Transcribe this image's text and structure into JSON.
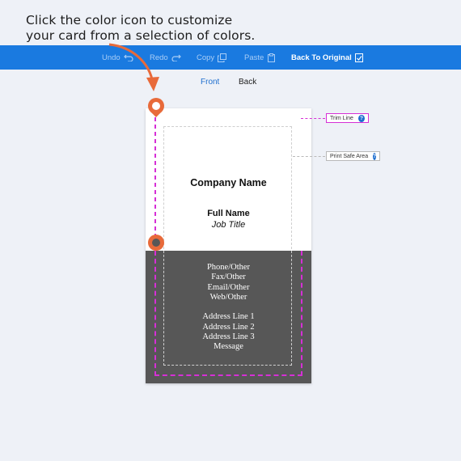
{
  "instruction": {
    "line1": "Click the color icon to customize",
    "line2": "your card from a selection of colors."
  },
  "toolbar": {
    "undo": {
      "label": "Undo",
      "icon": "undo-icon"
    },
    "redo": {
      "label": "Redo",
      "icon": "redo-icon"
    },
    "copy": {
      "label": "Copy",
      "icon": "copy-icon"
    },
    "paste": {
      "label": "Paste",
      "icon": "paste-icon"
    },
    "back_to_original": {
      "label": "Back To Original",
      "icon": "reset-icon"
    },
    "background_color": "#1a7ae0"
  },
  "tabs": [
    {
      "label": "Front",
      "active": true
    },
    {
      "label": "Back",
      "active": false
    }
  ],
  "card": {
    "company_name": "Company Name",
    "full_name": "Full Name",
    "job_title": "Job Title",
    "contact_lines": [
      "Phone/Other",
      "Fax/Other",
      "Email/Other",
      "Web/Other"
    ],
    "address_lines": [
      "Address Line 1",
      "Address Line 2",
      "Address Line 3",
      "Message"
    ],
    "top_color": "#ffffff",
    "bottom_color": "#575757"
  },
  "callouts": {
    "trim_line": "Trim Line",
    "print_safe_area": "Print Safe Area",
    "help_glyph": "?"
  },
  "colors": {
    "accent_orange": "#e86a3a",
    "trim_magenta": "#d62fd6",
    "tab_active": "#1f6fcf"
  }
}
